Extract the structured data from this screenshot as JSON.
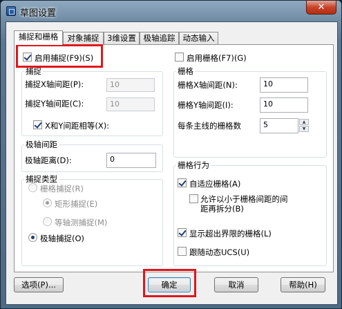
{
  "window": {
    "title": "草图设置",
    "close_symbol": "✕"
  },
  "tabs": [
    {
      "label": "捕捉和栅格",
      "active": true
    },
    {
      "label": "对象捕捉",
      "active": false
    },
    {
      "label": "3维设置",
      "active": false
    },
    {
      "label": "极轴追踪",
      "active": false
    },
    {
      "label": "动态输入",
      "active": false
    }
  ],
  "snap": {
    "enable_label": "启用捕捉(F9)(S)",
    "enable_checked": true,
    "group_label": "捕捉",
    "x_spacing_label": "捕捉X轴间距(P):",
    "x_spacing_value": "10",
    "y_spacing_label": "捕捉Y轴间距(C):",
    "y_spacing_value": "10",
    "equal_xy_label": "X和Y间距相等(X):",
    "equal_xy_checked": true
  },
  "polar": {
    "group_label": "极轴间距",
    "distance_label": "极轴距离(D):",
    "distance_value": "0"
  },
  "snap_type": {
    "group_label": "捕捉类型",
    "grid_snap_label": "栅格捕捉(R)",
    "rectangular_label": "矩形捕捉(E)",
    "isometric_label": "等轴测捕捉(M)",
    "polar_snap_label": "极轴捕捉(O)",
    "selected": "polar_snap"
  },
  "grid": {
    "enable_label": "启用栅格(F7)(G)",
    "enable_checked": false,
    "group_label": "栅格",
    "x_spacing_label": "栅格X轴间距(N):",
    "x_spacing_value": "10",
    "y_spacing_label": "栅格Y轴间距(I):",
    "y_spacing_value": "10",
    "major_line_label": "每条主线的栅格数",
    "major_line_value": "5",
    "spin_up": "▲",
    "spin_down": "▼"
  },
  "grid_behavior": {
    "group_label": "栅格行为",
    "adaptive_label": "自适应栅格(A)",
    "adaptive_checked": true,
    "subdivide_label_1": "允许以小于栅格间距的间",
    "subdivide_label_2": "距再拆分(B)",
    "subdivide_checked": false,
    "beyond_limits_label": "显示超出界限的栅格(L)",
    "beyond_limits_checked": true,
    "follow_ucs_label": "跟随动态UCS(U)",
    "follow_ucs_checked": false
  },
  "buttons": {
    "options": "选项(P)...",
    "ok": "确定",
    "cancel": "取消",
    "help": "帮助(H)"
  },
  "colors": {
    "highlight": "#e0151a",
    "title_bar": "#6f8aa4",
    "close_button": "#c7442a"
  }
}
